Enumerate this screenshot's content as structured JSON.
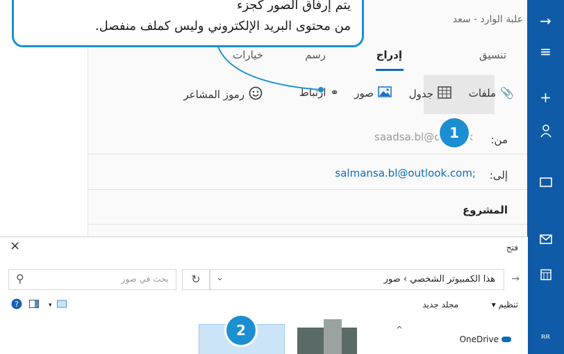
{
  "callout": {
    "line1": "يتم إرفاق الصور كجزء",
    "line2": "من محتوى البريد الإلكتروني وليس كملف منفصل."
  },
  "compose": {
    "title": "علبة الوارد - سعد",
    "tabs": [
      {
        "label": "تنسيق"
      },
      {
        "label": "إدراج"
      },
      {
        "label": "رسم"
      },
      {
        "label": "خيارات"
      }
    ],
    "toolbar": {
      "files": "ملفات",
      "table": "جدول",
      "pictures": "صور",
      "link": "ارتباط",
      "emoji": "رموز المشاعر"
    },
    "from_label": "من:",
    "from_value": "saadsa.bl@outlook",
    "to_label": "إلى:",
    "to_value": "salmansa.bl@outlook.com;",
    "subject": "المشروع"
  },
  "badges": {
    "one": "1",
    "two": "2"
  },
  "dialog": {
    "title": "فتح",
    "close": "×",
    "address": "هذا الكمبيوتر الشخصي › صور",
    "search_placeholder": "بحث في صور",
    "organize": "تنظيم ▾",
    "new_folder": "مجلد جديد",
    "onedrive": "OneDrive"
  },
  "colors": {
    "accent": "#1b8fd2",
    "appbar": "#0f5ba7",
    "link": "#0b6cbd"
  }
}
